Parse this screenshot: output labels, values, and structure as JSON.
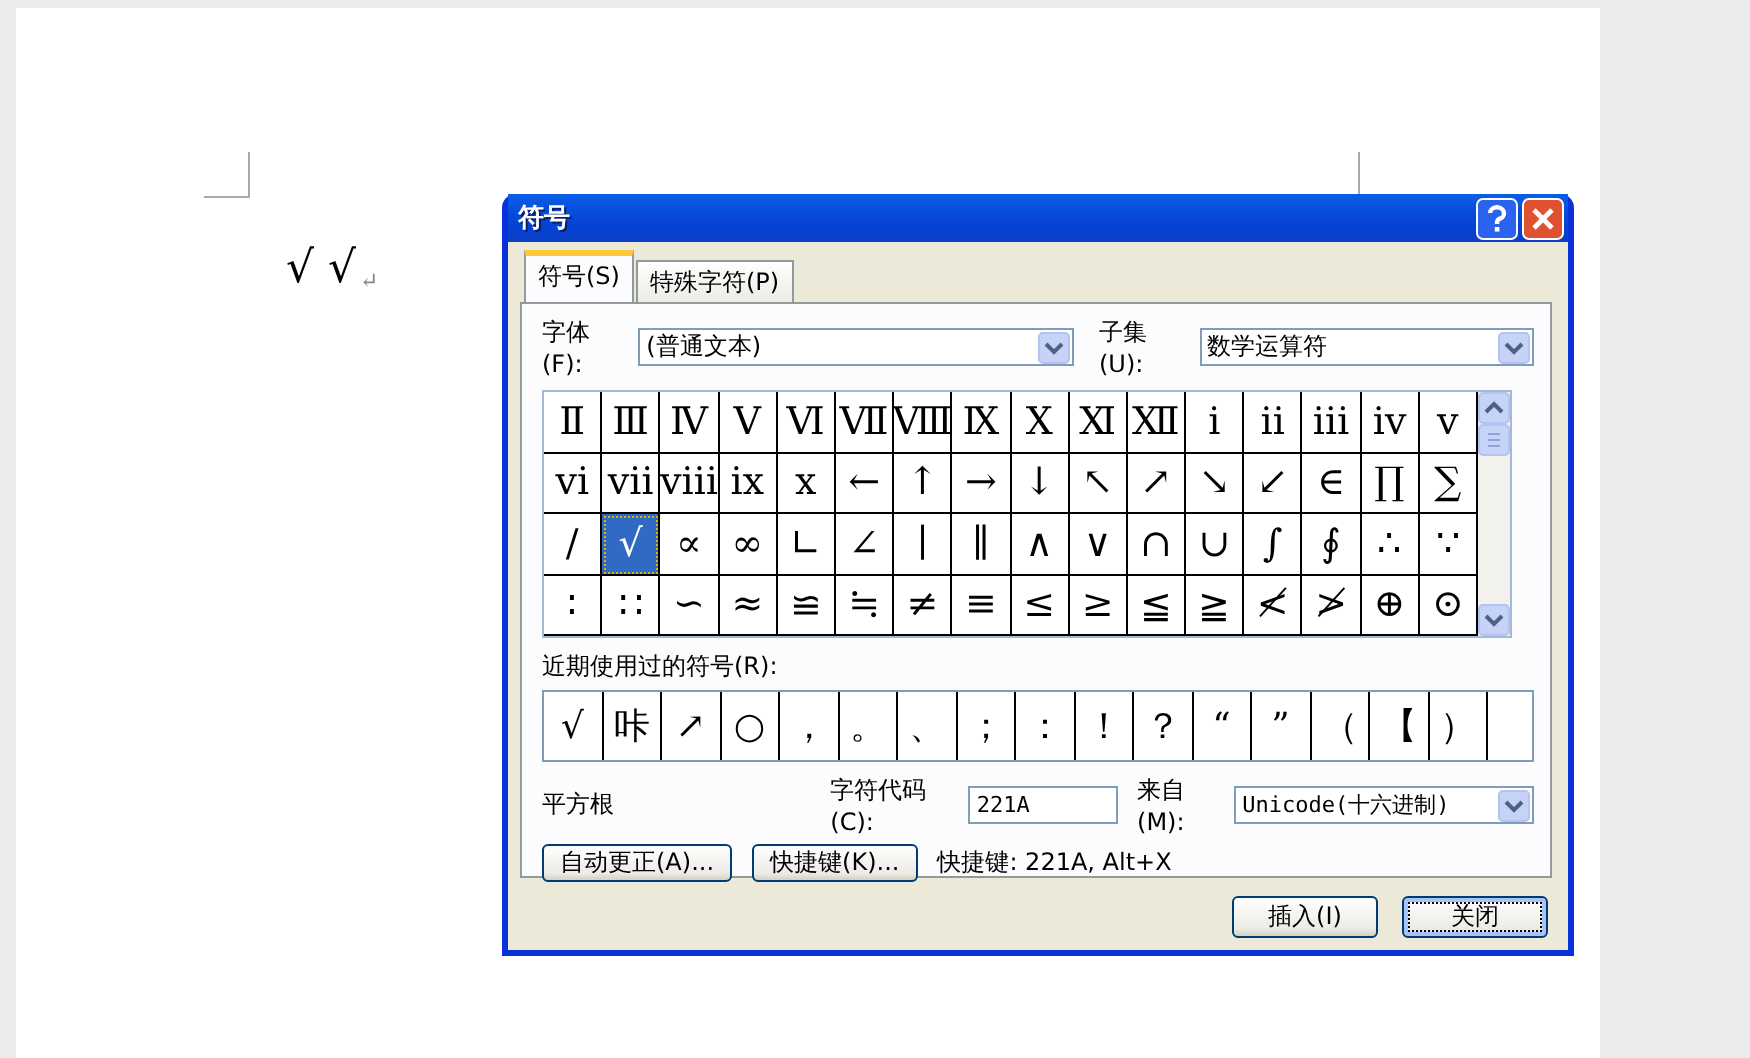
{
  "document": {
    "text": "√ √",
    "paragraph_mark": "↵"
  },
  "dialog": {
    "title": "符号",
    "tabs": [
      {
        "label": "符号(S)",
        "selected": true
      },
      {
        "label": "特殊字符(P)",
        "selected": false
      }
    ],
    "font_label": "字体(F):",
    "font_value": "(普通文本)",
    "subset_label": "子集(U):",
    "subset_value": "数学运算符",
    "symbols": [
      {
        "char": "Ⅱ",
        "selected": false
      },
      {
        "char": "Ⅲ",
        "selected": false
      },
      {
        "char": "Ⅳ",
        "selected": false
      },
      {
        "char": "Ⅴ",
        "selected": false
      },
      {
        "char": "Ⅵ",
        "selected": false
      },
      {
        "char": "Ⅶ",
        "selected": false
      },
      {
        "char": "Ⅷ",
        "selected": false
      },
      {
        "char": "Ⅸ",
        "selected": false
      },
      {
        "char": "Ⅹ",
        "selected": false
      },
      {
        "char": "Ⅺ",
        "selected": false
      },
      {
        "char": "Ⅻ",
        "selected": false
      },
      {
        "char": "ⅰ",
        "selected": false
      },
      {
        "char": "ⅱ",
        "selected": false
      },
      {
        "char": "ⅲ",
        "selected": false
      },
      {
        "char": "ⅳ",
        "selected": false
      },
      {
        "char": "ⅴ",
        "selected": false
      },
      {
        "char": "ⅵ",
        "selected": false
      },
      {
        "char": "ⅶ",
        "selected": false
      },
      {
        "char": "ⅷ",
        "selected": false
      },
      {
        "char": "ⅸ",
        "selected": false
      },
      {
        "char": "ⅹ",
        "selected": false
      },
      {
        "char": "←",
        "selected": false
      },
      {
        "char": "↑",
        "selected": false
      },
      {
        "char": "→",
        "selected": false
      },
      {
        "char": "↓",
        "selected": false
      },
      {
        "char": "↖",
        "selected": false
      },
      {
        "char": "↗",
        "selected": false
      },
      {
        "char": "↘",
        "selected": false
      },
      {
        "char": "↙",
        "selected": false
      },
      {
        "char": "∈",
        "selected": false
      },
      {
        "char": "∏",
        "selected": false
      },
      {
        "char": "∑",
        "selected": false
      },
      {
        "char": "∕",
        "selected": false
      },
      {
        "char": "√",
        "selected": true
      },
      {
        "char": "∝",
        "selected": false
      },
      {
        "char": "∞",
        "selected": false
      },
      {
        "char": "∟",
        "selected": false
      },
      {
        "char": "∠",
        "selected": false
      },
      {
        "char": "∣",
        "selected": false
      },
      {
        "char": "∥",
        "selected": false
      },
      {
        "char": "∧",
        "selected": false
      },
      {
        "char": "∨",
        "selected": false
      },
      {
        "char": "∩",
        "selected": false
      },
      {
        "char": "∪",
        "selected": false
      },
      {
        "char": "∫",
        "selected": false
      },
      {
        "char": "∮",
        "selected": false
      },
      {
        "char": "∴",
        "selected": false
      },
      {
        "char": "∵",
        "selected": false
      },
      {
        "char": "∶",
        "selected": false
      },
      {
        "char": "∷",
        "selected": false
      },
      {
        "char": "∽",
        "selected": false
      },
      {
        "char": "≈",
        "selected": false
      },
      {
        "char": "≌",
        "selected": false
      },
      {
        "char": "≒",
        "selected": false
      },
      {
        "char": "≠",
        "selected": false
      },
      {
        "char": "≡",
        "selected": false
      },
      {
        "char": "≤",
        "selected": false
      },
      {
        "char": "≥",
        "selected": false
      },
      {
        "char": "≦",
        "selected": false
      },
      {
        "char": "≧",
        "selected": false
      },
      {
        "char": "≮",
        "selected": false
      },
      {
        "char": "≯",
        "selected": false
      },
      {
        "char": "⊕",
        "selected": false
      },
      {
        "char": "⊙",
        "selected": false
      }
    ],
    "recent_label": "近期使用过的符号(R):",
    "recent": [
      "√",
      "咔",
      "↗",
      "○",
      "，",
      "。",
      "、",
      "；",
      "：",
      "！",
      "？",
      "“",
      "”",
      "（",
      "【",
      "）"
    ],
    "char_name": "平方根",
    "code_label": "字符代码(C):",
    "code_value": "221A",
    "from_label": "来自(M):",
    "from_value": "Unicode(十六进制)",
    "autocorrect_button": "自动更正(A)...",
    "shortcut_button": "快捷键(K)...",
    "shortcut_text": "快捷键: 221A, Alt+X",
    "insert_button": "插入(I)",
    "close_button": "关闭"
  }
}
